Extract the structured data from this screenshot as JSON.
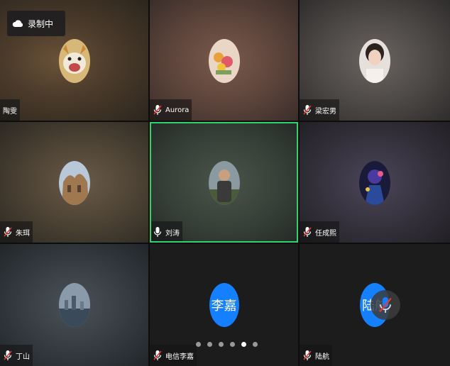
{
  "recording": {
    "label": "录制中",
    "icon": "cloud-icon"
  },
  "participants": [
    {
      "name": "陶雯",
      "mic": "muted",
      "avatar_type": "photo",
      "avatar_desc": "dog-photo"
    },
    {
      "name": "Aurora",
      "mic": "muted",
      "avatar_type": "photo",
      "avatar_desc": "flowers-photo"
    },
    {
      "name": "梁宏男",
      "mic": "muted",
      "avatar_type": "photo",
      "avatar_desc": "person-photo"
    },
    {
      "name": "朱珥",
      "mic": "muted",
      "avatar_type": "photo",
      "avatar_desc": "building-photo"
    },
    {
      "name": "刘涛",
      "mic": "on",
      "avatar_type": "photo",
      "avatar_desc": "person-photo",
      "speaking": true
    },
    {
      "name": "任成熙",
      "mic": "muted",
      "avatar_type": "photo",
      "avatar_desc": "anime-photo"
    },
    {
      "name": "丁山",
      "mic": "muted",
      "avatar_type": "photo",
      "avatar_desc": "city-photo"
    },
    {
      "name": "电信李嘉",
      "mic": "muted",
      "avatar_type": "text",
      "avatar_text": "李嘉"
    },
    {
      "name": "陆航",
      "mic": "muted",
      "avatar_type": "text",
      "avatar_text": "陆航"
    }
  ],
  "pagination": {
    "pages": 6,
    "current": 5
  },
  "colors": {
    "active_border": "#2bd46e",
    "text_avatar": "#1580ff"
  }
}
